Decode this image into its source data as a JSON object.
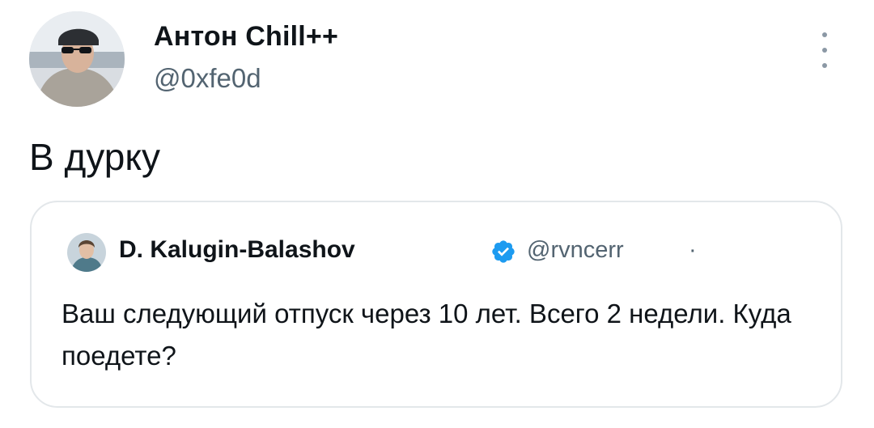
{
  "author": {
    "display_name": "Антон Chill++",
    "handle": "@0xfe0d",
    "avatar_icon": "user-avatar"
  },
  "tweet": {
    "text": "В дурку"
  },
  "menu": {
    "icon": "more-vertical-icon"
  },
  "quoted_tweet": {
    "display_name": "D. Kalugin-Balashov",
    "verified_icon": "verified-badge-icon",
    "handle": "@rvncerr",
    "separator": "·",
    "text": "Ваш следующий отпуск через 10 лет. Всего 2 недели. Куда поедете?"
  },
  "colors": {
    "text_primary": "#0f1419",
    "text_secondary": "#536471",
    "verified_blue": "#1d9bf0",
    "border": "#e3e7ea"
  }
}
